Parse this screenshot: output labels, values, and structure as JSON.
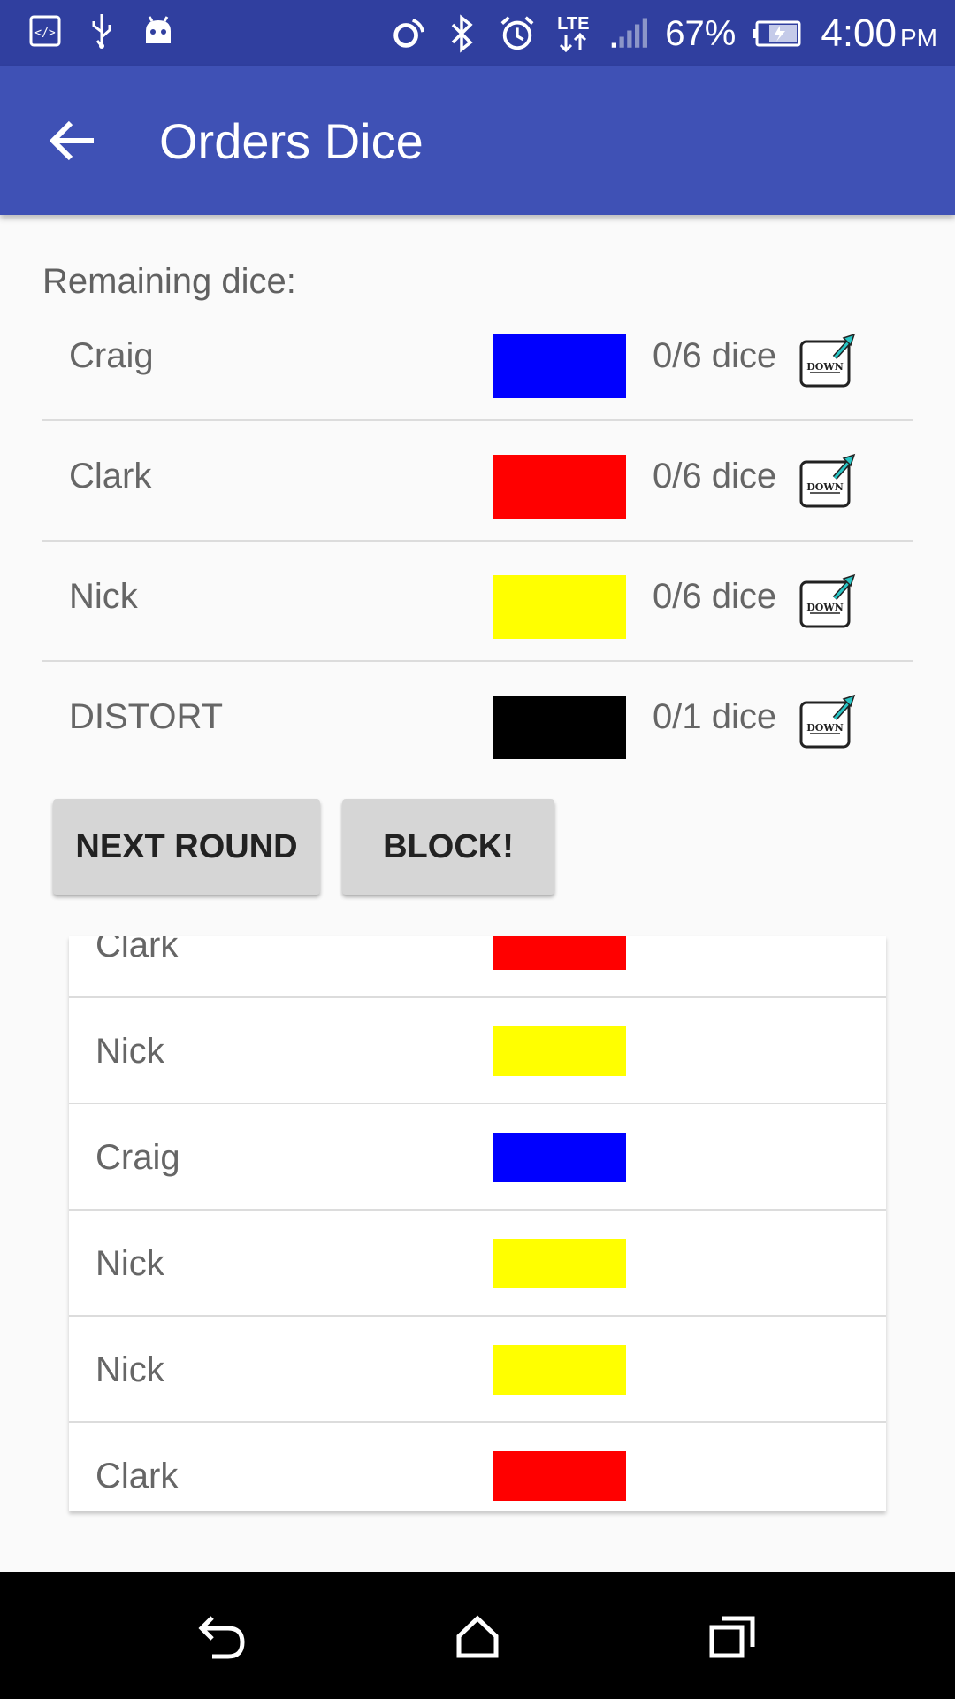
{
  "status_bar": {
    "battery": "67%",
    "time": "4:00",
    "ampm": "PM",
    "network": "LTE"
  },
  "app_bar": {
    "title": "Orders Dice"
  },
  "remaining": {
    "label": "Remaining dice:",
    "rows": [
      {
        "name": "Craig",
        "color": "#0000ff",
        "count": "0/6 dice"
      },
      {
        "name": "Clark",
        "color": "#ff0000",
        "count": "0/6 dice"
      },
      {
        "name": "Nick",
        "color": "#ffff00",
        "count": "0/6 dice"
      },
      {
        "name": "DISTORT",
        "color": "#000000",
        "count": "0/1 dice"
      }
    ],
    "icon": "draw-down-icon",
    "icon_text": "DOWN"
  },
  "buttons": {
    "next_round": "NEXT ROUND",
    "block": "BLOCK!"
  },
  "rolled": [
    {
      "name": "Clark",
      "color": "#ff0000"
    },
    {
      "name": "Nick",
      "color": "#ffff00"
    },
    {
      "name": "Craig",
      "color": "#0000ff"
    },
    {
      "name": "Nick",
      "color": "#ffff00"
    },
    {
      "name": "Nick",
      "color": "#ffff00"
    },
    {
      "name": "Clark",
      "color": "#ff0000"
    }
  ],
  "colors": {
    "status_bar": "#303f9f",
    "app_bar": "#3f51b5"
  }
}
